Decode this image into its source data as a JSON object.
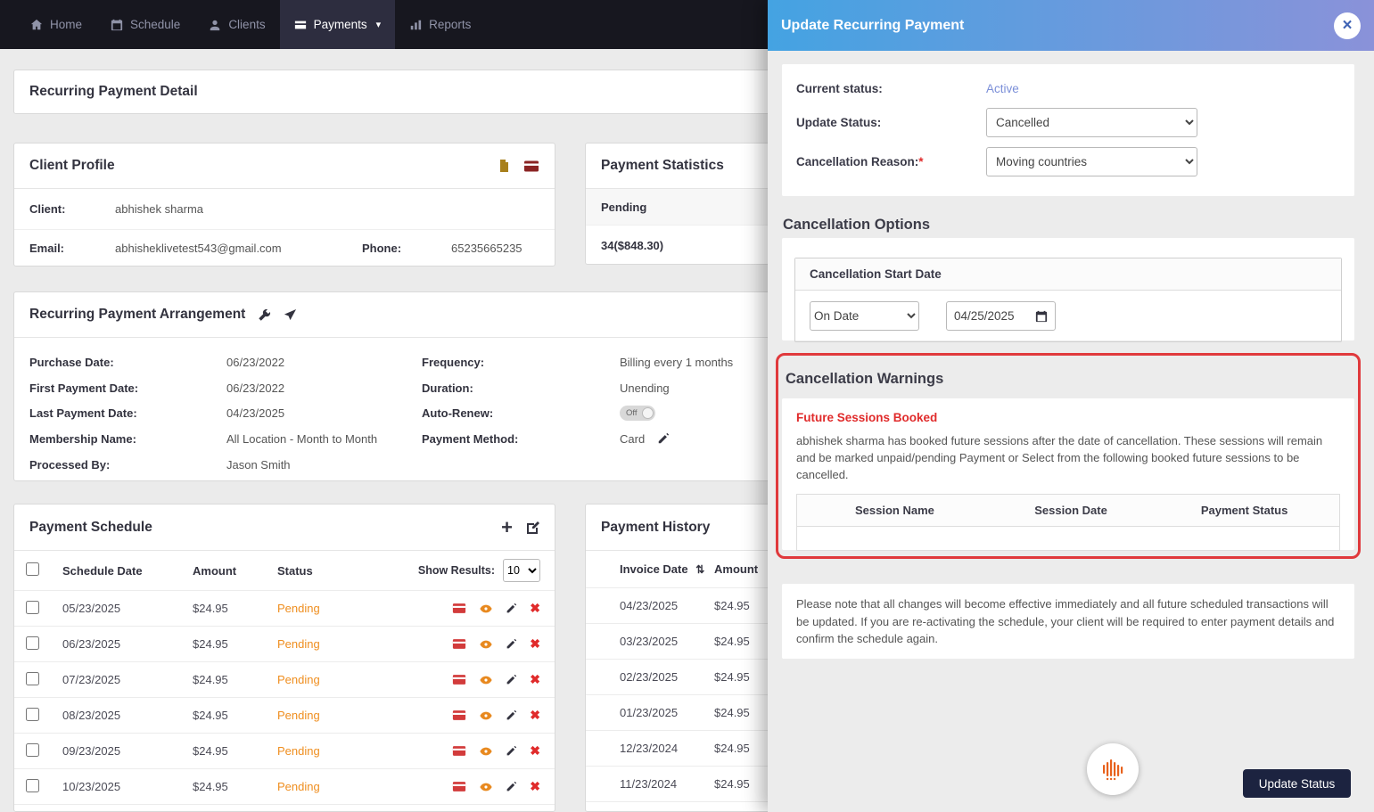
{
  "colors": {
    "accent_orange": "#ef8e1f",
    "danger_red": "#e02b2b",
    "link_blue": "#7b8fd8",
    "modal_gradient_start": "#44a3e2",
    "modal_gradient_end": "#8a92d9",
    "button_dark": "#1c2340",
    "warning_border": "#e0393c"
  },
  "icons": {
    "close": "×",
    "caret": "▾",
    "sort": "⇅",
    "plus": "+",
    "delete": "✖"
  },
  "navbar": {
    "items": [
      {
        "label": "Home"
      },
      {
        "label": "Schedule"
      },
      {
        "label": "Clients"
      },
      {
        "label": "Payments"
      },
      {
        "label": "Reports"
      }
    ]
  },
  "page": {
    "title": "Recurring Payment Detail"
  },
  "client_profile": {
    "title": "Client Profile",
    "client_label": "Client:",
    "client_value": "abhishek sharma",
    "email_label": "Email:",
    "email_value": "abhisheklivetest543@gmail.com",
    "phone_label": "Phone:",
    "phone_value": "65235665235"
  },
  "payment_statistics": {
    "title": "Payment Statistics",
    "pending_label": "Pending",
    "pending_value": "34($848.30)"
  },
  "arrangement": {
    "title": "Recurring Payment Arrangement",
    "purchase_date_label": "Purchase Date:",
    "purchase_date": "06/23/2022",
    "first_payment_label": "First Payment Date:",
    "first_payment": "06/23/2022",
    "last_payment_label": "Last Payment Date:",
    "last_payment": "04/23/2025",
    "membership_label": "Membership Name:",
    "membership": "All Location - Month to Month",
    "processed_by_label": "Processed By:",
    "processed_by": "Jason Smith",
    "frequency_label": "Frequency:",
    "frequency": "Billing every 1 months",
    "duration_label": "Duration:",
    "duration": "Unending",
    "auto_renew_label": "Auto-Renew:",
    "auto_renew": "Off",
    "payment_method_label": "Payment Method:",
    "payment_method": "Card"
  },
  "payment_schedule": {
    "title": "Payment Schedule",
    "col_date": "Schedule Date",
    "col_amount": "Amount",
    "col_status": "Status",
    "show_results_label": "Show Results:",
    "show_results_value": "10",
    "rows": [
      {
        "date": "05/23/2025",
        "amount": "$24.95",
        "status": "Pending"
      },
      {
        "date": "06/23/2025",
        "amount": "$24.95",
        "status": "Pending"
      },
      {
        "date": "07/23/2025",
        "amount": "$24.95",
        "status": "Pending"
      },
      {
        "date": "08/23/2025",
        "amount": "$24.95",
        "status": "Pending"
      },
      {
        "date": "09/23/2025",
        "amount": "$24.95",
        "status": "Pending"
      },
      {
        "date": "10/23/2025",
        "amount": "$24.95",
        "status": "Pending"
      }
    ]
  },
  "payment_history": {
    "title": "Payment History",
    "col_invoice_date": "Invoice Date",
    "col_amount": "Amount",
    "rows": [
      {
        "date": "04/23/2025",
        "amount": "$24.95"
      },
      {
        "date": "03/23/2025",
        "amount": "$24.95"
      },
      {
        "date": "02/23/2025",
        "amount": "$24.95"
      },
      {
        "date": "01/23/2025",
        "amount": "$24.95"
      },
      {
        "date": "12/23/2024",
        "amount": "$24.95"
      },
      {
        "date": "11/23/2024",
        "amount": "$24.95"
      }
    ]
  },
  "modal": {
    "title": "Update Recurring Payment",
    "current_status_label": "Current status:",
    "current_status_value": "Active",
    "update_status_label": "Update Status:",
    "update_status_value": "Cancelled",
    "cancellation_reason_label": "Cancellation Reason:",
    "required_mark": "*",
    "cancellation_reason_value": "Moving countries",
    "options_title": "Cancellation Options",
    "start_date_title": "Cancellation Start Date",
    "start_date_mode": "On Date",
    "start_date_value": "04/25/2025",
    "warnings_title": "Cancellation Warnings",
    "warning_heading": "Future Sessions Booked",
    "warning_text": "abhishek sharma has booked future sessions after the date of cancellation. These sessions will remain and be marked unpaid/pending Payment or Select from the following booked future sessions to be cancelled.",
    "warning_cols": [
      "Session Name",
      "Session Date",
      "Payment Status"
    ],
    "note_text": "Please note that all changes will become effective immediately and all future scheduled transactions will be updated. If you are re-activating the schedule, your client will be required to enter payment details and confirm the schedule again.",
    "update_button": "Update Status"
  }
}
